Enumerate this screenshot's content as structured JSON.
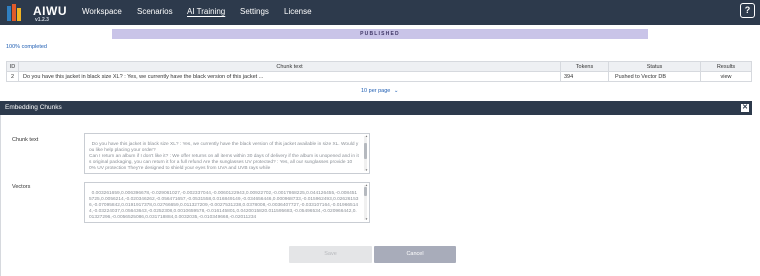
{
  "app": {
    "logo_text": "AIWU",
    "version": "v1.2.3"
  },
  "nav": {
    "items": [
      {
        "label": "Workspace",
        "active": false
      },
      {
        "label": "Scenarios",
        "active": false
      },
      {
        "label": "AI Training",
        "active": true
      },
      {
        "label": "Settings",
        "active": false
      },
      {
        "label": "License",
        "active": false
      }
    ],
    "help_icon": "?"
  },
  "page": {
    "status_banner": "PUBLISHED",
    "progress_text": "100% completed",
    "table": {
      "headers": {
        "id": "ID",
        "chunk_text": "Chunk text",
        "tokens": "Tokens",
        "status": "Status",
        "results": "Results"
      },
      "rows": [
        {
          "id": "2",
          "chunk_text": "Do you have this jacket in black size XL? : Yes, we currently have the black version of this jacket ...",
          "tokens": "394",
          "status": "Pushed to Vector DB",
          "results": "view"
        }
      ]
    },
    "pagination": {
      "per_page": "10 per page",
      "chevron": "⌄"
    }
  },
  "modal": {
    "title": "Embedding Chunks",
    "close_icon": "✕",
    "chunk_text_label": "Chunk text",
    "chunk_text_value": "Do you have this jacket in black size XL? : Yes, we currently have the black version of this jacket available in size XL. Would you like help placing your order?\nCan I return an album if I don't like it? : We offer returns on all items within 30 days of delivery if the album is unopened and in its original packaging, you can return it for a full refund Are the sunglasses UV protected? : Yes, all our sunglasses provide 100% UV protection They're designed to shield your eyes from UVA and UVB rays while",
    "vectors_label": "Vectors",
    "vectors_value": "0.003261659,0.006396678,-0.029061027,-0.002337044,-0.0060122943,0.00922702,-0.0017868225,0.044126455,-0.0084515725,0.0056214,-0.020346262,-0.056471657,-0.0531558,0.016849149,-0.034656446,0.000968733,-0.015962493,0.026261536,-0.07095842,0.0191917378,0.02766659,0.011327209,-0.0027531238,0.0378008,-0.0036407727,-0.033107164,-0.019665144,-0.03224037,0.05643643,-0.0252308,0.0010659578,-0.016145801,0.0420015820.011595683,-0.05496534,-0.020966442,0.01327296,-0.0056525086,0.031718884,0.0032035,-0.010349668,-0.02011234",
    "save_label": "Save",
    "cancel_label": "Cancel"
  }
}
